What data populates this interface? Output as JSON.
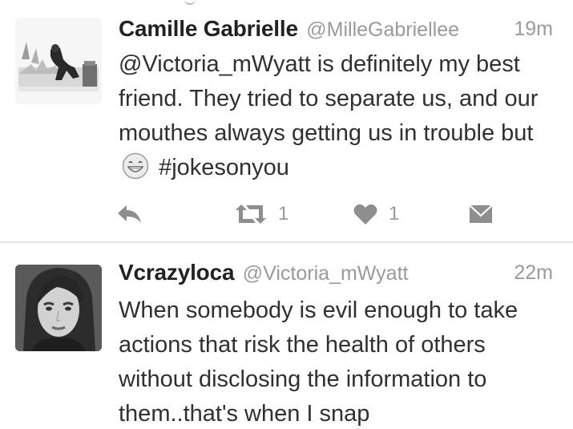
{
  "timeline": {
    "tweets": [
      {
        "display_name": "Camille Gabrielle",
        "handle": "@MilleGabriellee",
        "time": "19m",
        "text_before_emoji": "@Victoria_mWyatt is definitely my best friend. They tried to separate us, and our mouthes always getting us in trouble but",
        "emoji": "grinning-face-emoji",
        "text_after_emoji": "#jokesonyou",
        "retweet_count": "1",
        "like_count": "1"
      },
      {
        "display_name": "Vcrazyloca",
        "handle": "@Victoria_mWyatt",
        "time": "22m",
        "text": "When somebody is evil enough to take actions that risk the health of others without disclosing the information to them..that's when I snap"
      }
    ]
  },
  "icons": {
    "reply": "reply-icon",
    "retweet": "retweet-icon",
    "like": "heart-icon",
    "direct_message": "envelope-icon"
  },
  "colors": {
    "text": "#303030",
    "muted": "#9a9a9a",
    "divider": "#e3e3e3"
  }
}
